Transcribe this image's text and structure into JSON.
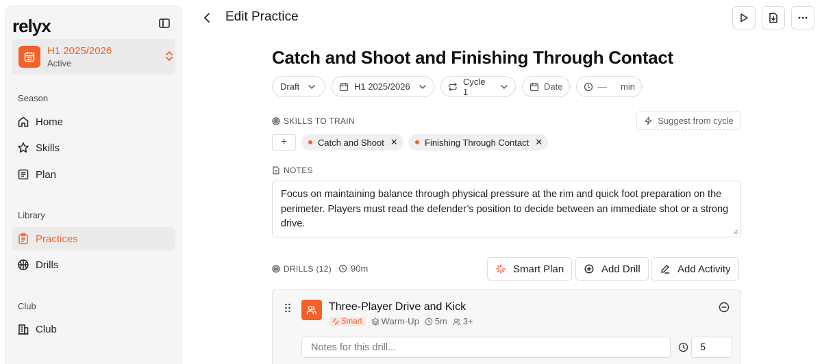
{
  "brand": {
    "logo": "relyx",
    "accent": "#f2612a"
  },
  "season": {
    "title": "H1 2025/2026",
    "status": "Active"
  },
  "sidebar": {
    "sections": [
      {
        "label": "Season"
      },
      {
        "label": "Library"
      },
      {
        "label": "Club"
      }
    ],
    "items": [
      {
        "label": "Home",
        "icon": "home-icon"
      },
      {
        "label": "Skills",
        "icon": "star-icon"
      },
      {
        "label": "Plan",
        "icon": "list-icon"
      },
      {
        "label": "Practices",
        "icon": "clipboard-icon",
        "active": true
      },
      {
        "label": "Drills",
        "icon": "basketball-icon"
      },
      {
        "label": "Club",
        "icon": "building-icon"
      }
    ]
  },
  "header": {
    "title": "Edit Practice"
  },
  "practice": {
    "title": "Catch and Shoot and Finishing Through Contact",
    "status": "Draft",
    "season": "H1 2025/2026",
    "cycle": "Cycle 1",
    "date_placeholder": "Date",
    "duration_value": "—",
    "duration_unit": "min"
  },
  "skills": {
    "label": "SKILLS TO TRAIN",
    "suggest_label": "Suggest from cycle",
    "add_label": "+",
    "chips": [
      "Catch and Shoot",
      "Finishing Through Contact"
    ],
    "remove_glyph": "✕"
  },
  "notes": {
    "label": "NOTES",
    "text": "Focus on maintaining balance through physical pressure at the rim and quick foot preparation on the perimeter. Players must read the defender’s position to decide between an immediate shot or a strong drive."
  },
  "drills": {
    "label": "DRILLS (12)",
    "total_duration": "90m",
    "smart_plan_label": "Smart Plan",
    "add_drill_label": "Add Drill",
    "add_activity_label": "Add Activity",
    "items": [
      {
        "name": "Three-Player Drive and Kick",
        "tag": "Smart",
        "category": "Warm-Up",
        "duration": "5m",
        "players": "3+",
        "notes_placeholder": "Notes for this drill...",
        "minutes": "5"
      }
    ]
  }
}
